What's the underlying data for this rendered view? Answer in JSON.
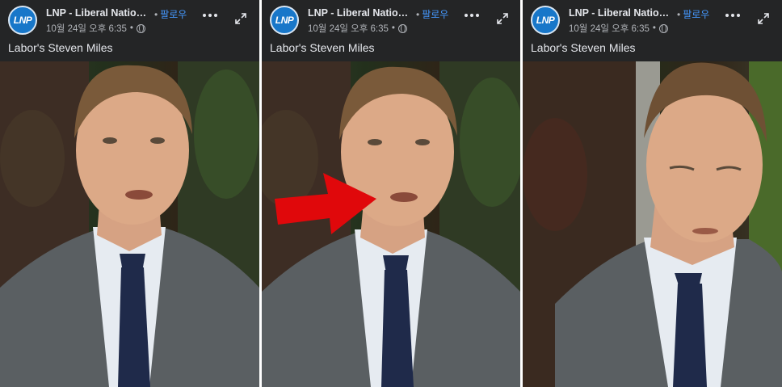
{
  "posts": [
    {
      "page_name": "LNP - Liberal National...",
      "follow_label": "팔로우",
      "timestamp": "10월 24일 오후 6:35",
      "caption": "Labor's Steven Miles",
      "avatar_text": "LNP"
    },
    {
      "page_name": "LNP - Liberal National...",
      "follow_label": "팔로우",
      "timestamp": "10월 24일 오후 6:35",
      "caption": "Labor's Steven Miles",
      "avatar_text": "LNP"
    },
    {
      "page_name": "LNP - Liberal National...",
      "follow_label": "팔로우",
      "timestamp": "10월 24일 오후 6:35",
      "caption": "Labor's Steven Miles",
      "avatar_text": "LNP"
    }
  ],
  "separator": "•",
  "colors": {
    "header_bg": "#242526",
    "follow_link": "#4599ff",
    "brand_blue": "#1877c9",
    "arrow_red": "#e0080b"
  },
  "icons": [
    "globe-icon",
    "more-options-icon",
    "expand-icon",
    "red-arrow-annotation"
  ]
}
